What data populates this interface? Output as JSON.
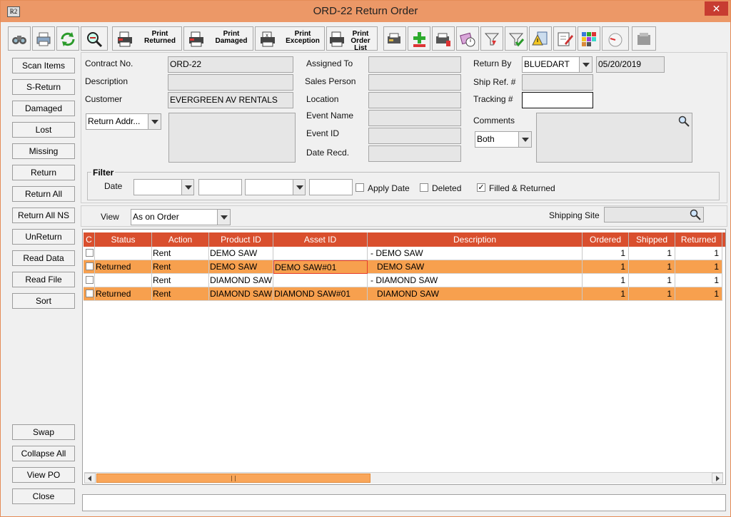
{
  "window": {
    "title": "ORD-22 Return Order",
    "icon_text": "R2",
    "close_label": "✕"
  },
  "toolbar": {
    "print_returned": [
      "Print",
      "Returned"
    ],
    "print_damaged": [
      "Print",
      "Damaged"
    ],
    "print_exception": [
      "Print",
      "Exception"
    ],
    "print_order_list": [
      "Print",
      "Order List"
    ]
  },
  "sidebar": {
    "top": [
      "Scan Items",
      "S-Return",
      "Damaged",
      "Lost",
      "Missing",
      "Return",
      "Return All",
      "Return All NS",
      "UnReturn",
      "Read Data",
      "Read File",
      "Sort"
    ],
    "bottom": [
      "Swap",
      "Collapse All",
      "View PO",
      "Close"
    ]
  },
  "form": {
    "contract_no_label": "Contract No.",
    "contract_no": "ORD-22",
    "description_label": "Description",
    "description": "",
    "customer_label": "Customer",
    "customer": "EVERGREEN AV RENTALS",
    "return_addr_select": "Return Addr...",
    "assigned_to_label": "Assigned To",
    "sales_person_label": "Sales Person",
    "location_label": "Location",
    "event_name_label": "Event Name",
    "event_id_label": "Event ID",
    "date_recd_label": "Date Recd.",
    "return_by_label": "Return By",
    "return_by": "BLUEDART",
    "return_date": "05/20/2019",
    "ship_ref_label": "Ship Ref. #",
    "tracking_label": "Tracking #",
    "comments_label": "Comments",
    "comments_select": "Both"
  },
  "filter": {
    "title": "Filter",
    "date_label": "Date",
    "apply_date_label": "Apply Date",
    "apply_date_checked": false,
    "deleted_label": "Deleted",
    "deleted_checked": false,
    "filled_returned_label": "Filled & Returned",
    "filled_returned_checked": true,
    "check_mark": "✓"
  },
  "view": {
    "label": "View",
    "value": "As on Order",
    "shipping_site_label": "Shipping Site"
  },
  "grid": {
    "columns": [
      "C",
      "Status",
      "Action",
      "Product ID",
      "Asset ID",
      "Description",
      "Ordered",
      "Shipped",
      "Returned"
    ],
    "rows": [
      {
        "status": "",
        "action": "Rent",
        "product_id": "DEMO SAW",
        "asset_id": "",
        "description": "- DEMO SAW",
        "ordered": "1",
        "shipped": "1",
        "returned": "1"
      },
      {
        "status": "Returned",
        "action": "Rent",
        "product_id": "DEMO SAW",
        "asset_id": "DEMO SAW#01",
        "description": "DEMO SAW",
        "ordered": "1",
        "shipped": "1",
        "returned": "1"
      },
      {
        "status": "",
        "action": "Rent",
        "product_id": "DIAMOND SAW",
        "asset_id": "",
        "description": "- DIAMOND SAW",
        "ordered": "1",
        "shipped": "1",
        "returned": "1"
      },
      {
        "status": "Returned",
        "action": "Rent",
        "product_id": "DIAMOND SAW",
        "asset_id": "DIAMOND SAW#01",
        "description": "DIAMOND SAW",
        "ordered": "1",
        "shipped": "1",
        "returned": "1"
      }
    ]
  },
  "colors": {
    "title_bar": "#ec9867",
    "header": "#d94f2e",
    "returned_row": "#f7a04e",
    "selection": "#e53b2a"
  },
  "icons": [
    "binoculars-icon",
    "printer-icon",
    "refresh-icon",
    "zoom-icon",
    "print-returned-icon",
    "print-damaged-icon",
    "print-exception-icon",
    "print-order-list-icon",
    "scanner-icon",
    "add-icon",
    "scanner-alert-icon",
    "calendar-clock-icon",
    "funnel-icon",
    "filter-check-icon",
    "warning-doc-icon",
    "edit-icon",
    "grid-colors-icon",
    "gauge-icon",
    "printer-disabled-icon",
    "search-icon",
    "arrow-left-icon",
    "arrow-right-icon"
  ]
}
